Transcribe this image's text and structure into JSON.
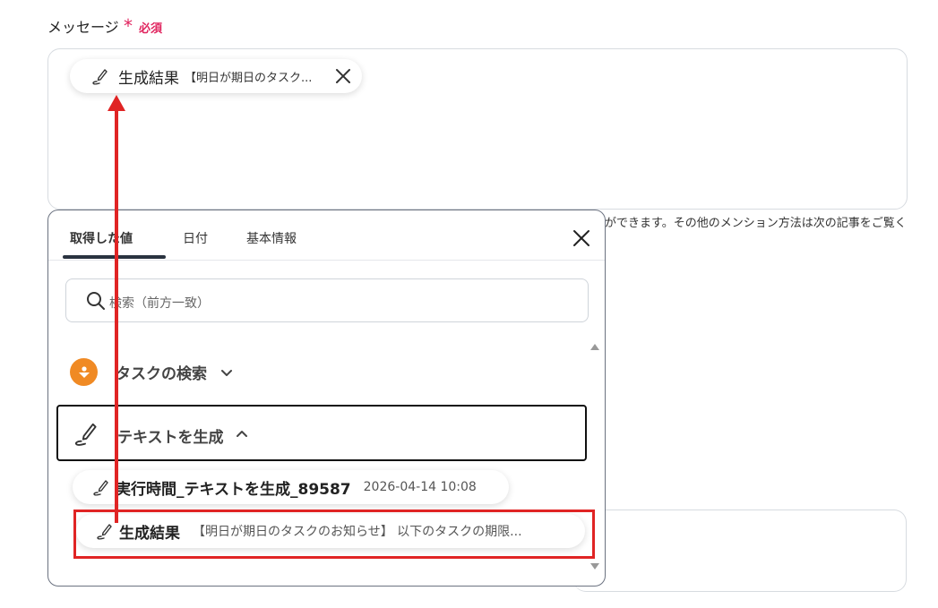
{
  "field": {
    "label": "メッセージ",
    "required_mark": "*",
    "required_text": "必須",
    "help_text": "ができます。その他のメンション方法は次の記事をご覧く"
  },
  "chip": {
    "icon": "pen-write-icon",
    "label": "生成結果",
    "preview": "【明日が期日のタスク..."
  },
  "panel": {
    "tabs": [
      {
        "label": "取得した値",
        "active": true
      },
      {
        "label": "日付",
        "active": false
      },
      {
        "label": "基本情報",
        "active": false
      }
    ],
    "search_placeholder": "検索（前方一致）",
    "sections": [
      {
        "label": "タスクの検索",
        "icon": "orange-app-icon",
        "expanded": false
      },
      {
        "label": "テキストを生成",
        "icon": "pen-write-icon",
        "expanded": true
      }
    ],
    "items": [
      {
        "label": "実行時間_テキストを生成_89587",
        "value": "2026-04-14 10:08"
      },
      {
        "label": "生成結果",
        "value": "【明日が期日のタスクのお知らせ】 以下のタスクの期限..."
      }
    ]
  },
  "colors": {
    "accent_red": "#e02424",
    "required_pink": "#e0245e",
    "app_orange": "#f08a24"
  }
}
